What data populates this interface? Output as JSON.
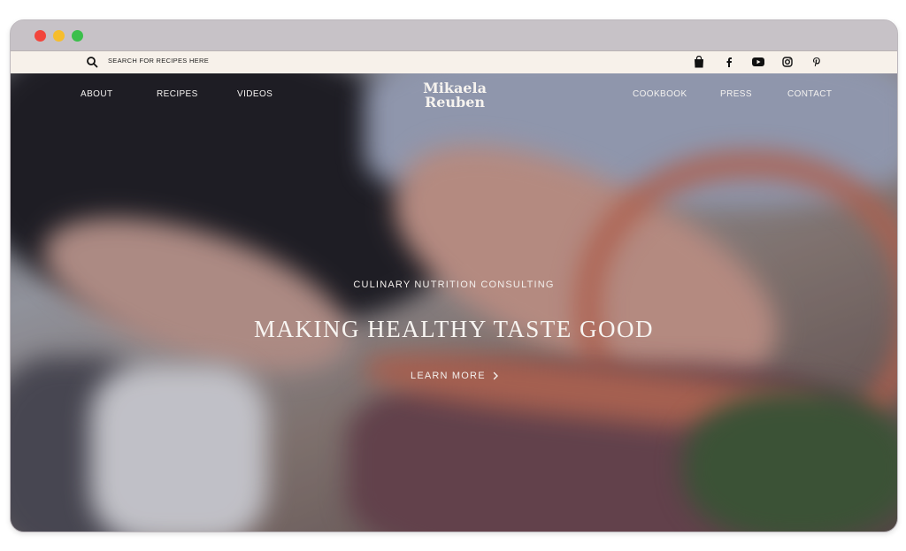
{
  "topbar": {
    "search_placeholder": "SEARCH FOR RECIPES HERE",
    "icons": [
      "shopping-bag-icon",
      "facebook-icon",
      "youtube-icon",
      "instagram-icon",
      "pinterest-icon"
    ]
  },
  "nav": {
    "logo_line1": "Mikaela",
    "logo_line2": "Reuben",
    "left": [
      "ABOUT",
      "RECIPES",
      "VIDEOS"
    ],
    "right": [
      "COOKBOOK",
      "PRESS",
      "CONTACT"
    ]
  },
  "hero": {
    "subtitle": "CULINARY NUTRITION CONSULTING",
    "headline": "MAKING HEALTHY TASTE GOOD",
    "cta": "LEARN MORE",
    "cta_icon": "chevron-right-icon"
  },
  "colors": {
    "window_dots": [
      "#f2453d",
      "#f6bd2c",
      "#3bbf4b"
    ],
    "topbar_bg": "#f7f1ea",
    "hero_text": "#f7f4f1"
  }
}
